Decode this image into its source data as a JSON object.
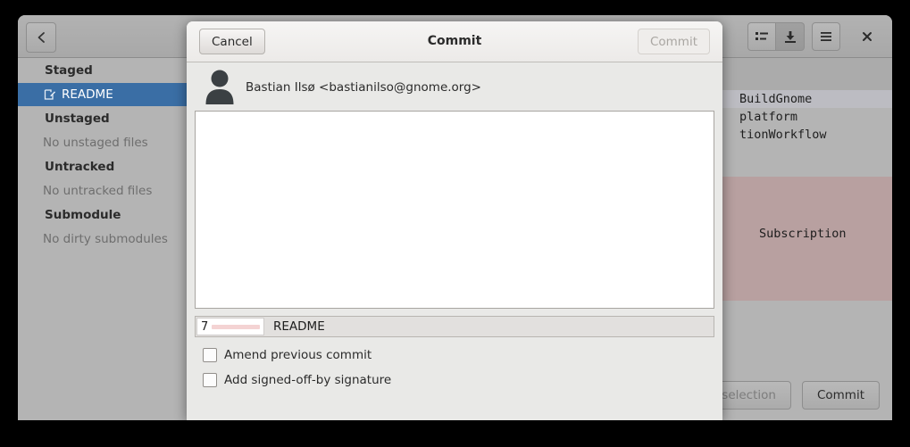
{
  "window": {
    "back_label": "‹",
    "toolbar": [
      {
        "name": "view-list-icon",
        "glyph": "list"
      },
      {
        "name": "download-icon",
        "glyph": "download"
      },
      {
        "name": "menu-icon",
        "glyph": "hamburger"
      },
      {
        "name": "close-icon",
        "glyph": "×"
      }
    ]
  },
  "sidebar": {
    "sections": [
      {
        "title": "Staged",
        "rows": [
          {
            "label": "README",
            "icon": "edit-file-icon",
            "selected": true
          }
        ]
      },
      {
        "title": "Unstaged",
        "rows": [
          {
            "label": "No unstaged files",
            "icon": "",
            "selected": false
          }
        ]
      },
      {
        "title": "Untracked",
        "rows": [
          {
            "label": "No untracked files",
            "icon": "",
            "selected": false
          }
        ]
      },
      {
        "title": "Submodule",
        "rows": [
          {
            "label": "No dirty submodules",
            "icon": "",
            "selected": false
          }
        ]
      }
    ],
    "selected_color": "#3a6ea5"
  },
  "code_pane": {
    "lines": [
      {
        "text": "BuildGnome",
        "highlight": true
      },
      {
        "text": "platform",
        "highlight": false
      },
      {
        "text": "tionWorkflow",
        "highlight": false
      }
    ],
    "diff_removed_label": "Subscription",
    "diff_removed_color": "#b8a0a0",
    "buttons": [
      {
        "label": "ge selection",
        "name": "stage-selection-button",
        "dim": true
      },
      {
        "label": "Commit",
        "name": "commit-button",
        "dim": false
      }
    ]
  },
  "dialog": {
    "title": "Commit",
    "cancel_label": "Cancel",
    "commit_label": "Commit",
    "commit_enabled": false,
    "author": "Bastian Ilsø <bastianilso@gnome.org>",
    "message_value": "",
    "message_placeholder": "",
    "stat": {
      "count": "7",
      "file": "README",
      "bar_color": "#f4d3d3"
    },
    "checkboxes": [
      {
        "label": "Amend previous commit",
        "checked": false,
        "name": "amend-previous-commit-checkbox"
      },
      {
        "label": "Add signed-off-by signature",
        "checked": false,
        "name": "add-signed-off-by-checkbox"
      }
    ]
  }
}
